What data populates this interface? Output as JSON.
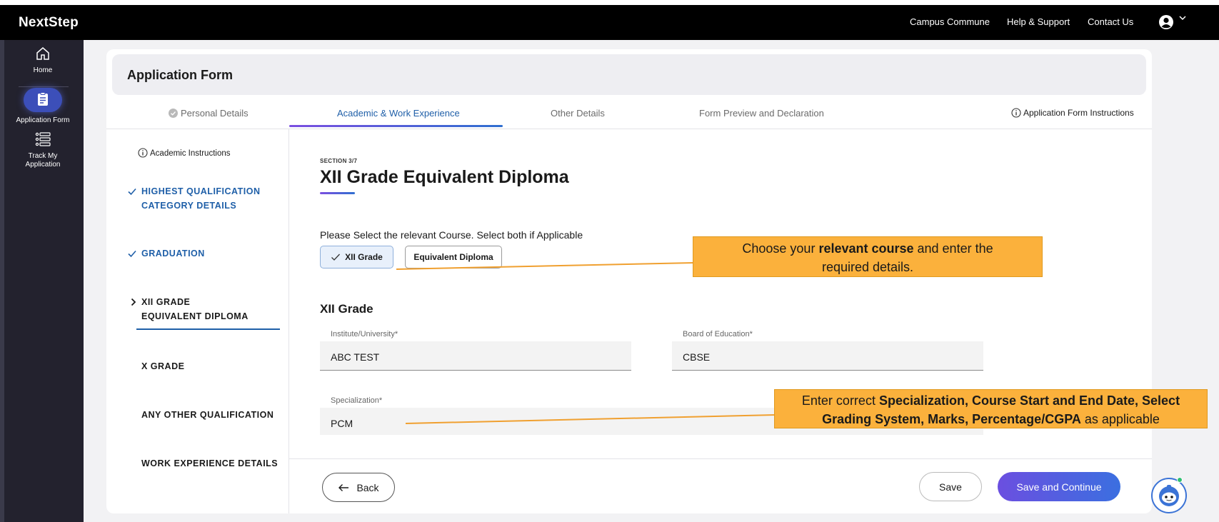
{
  "topbar": {
    "brand": "NextStep",
    "links": [
      "Campus Commune",
      "Help & Support",
      "Contact Us"
    ]
  },
  "leftrail": {
    "items": [
      {
        "label": "Home",
        "icon": "home-icon"
      },
      {
        "label": "Application Form",
        "icon": "clipboard-icon"
      },
      {
        "label": "Track My Application",
        "icon": "list-icon"
      }
    ]
  },
  "header": {
    "title": "Application Form"
  },
  "tabs": {
    "personal": "Personal Details",
    "academic": "Academic & Work Experience",
    "other": "Other Details",
    "preview": "Form Preview and Declaration",
    "instructions": "Application Form Instructions"
  },
  "section_nav": {
    "instructions": "Academic Instructions",
    "items": [
      "HIGHEST QUALIFICATION CATEGORY DETAILS",
      "GRADUATION",
      "XII GRADE EQUIVALENT DIPLOMA",
      "X GRADE",
      "ANY OTHER QUALIFICATION",
      "WORK EXPERIENCE DETAILS"
    ],
    "item_lines": {
      "highest_1": "HIGHEST QUALIFICATION",
      "highest_2": "CATEGORY DETAILS",
      "xii_1": "XII GRADE",
      "xii_2": "EQUIVALENT DIPLOMA"
    }
  },
  "main": {
    "section_label": "SECTION 3/7",
    "title": "XII Grade Equivalent Diploma",
    "prompt": "Please Select the relevant Course. Select both if Applicable",
    "chips": {
      "selected": "XII Grade",
      "unselected": "Equivalent Diploma"
    },
    "subhead": "XII Grade",
    "fields": {
      "institute_label": "Institute/University*",
      "institute_value": "ABC TEST",
      "board_label": "Board of Education*",
      "board_value": "CBSE",
      "specialization_label": "Specialization*",
      "specialization_value": "PCM"
    }
  },
  "buttons": {
    "back": "Back",
    "save": "Save",
    "continue": "Save and Continue"
  },
  "callouts": {
    "c1_a": "Choose your ",
    "c1_b": "relevant course",
    "c1_c": " and enter the",
    "c1_d": "required details.",
    "c2_a": "Enter correct ",
    "c2_b": "Specialization, Course Start and End Date, Select",
    "c2_c": "Grading System, Marks, Percentage/CGPA",
    "c2_d": " as applicable"
  },
  "colors": {
    "accent_blue": "#1f5fa8",
    "accent_purple": "#6b4fe0",
    "callout": "#fbb13c",
    "rail": "#23222e"
  }
}
